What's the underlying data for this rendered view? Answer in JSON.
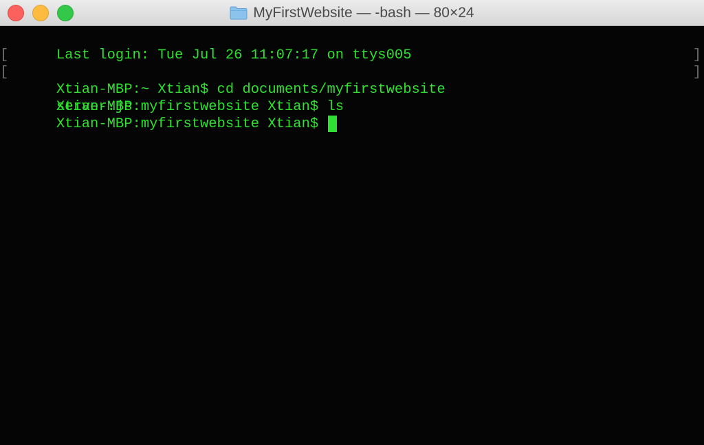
{
  "window": {
    "title": "MyFirstWebsite — -bash — 80×24"
  },
  "terminal": {
    "lines": [
      {
        "text": "Last login: Tue Jul 26 11:07:17 on ttys005",
        "marked": false
      },
      {
        "text": "Xtian-MBP:~ Xtian$ cd documents/myfirstwebsite",
        "marked": true
      },
      {
        "text": "Xtian-MBP:myfirstwebsite Xtian$ ls",
        "marked": true
      },
      {
        "text": "server.js",
        "marked": false
      },
      {
        "text": "Xtian-MBP:myfirstwebsite Xtian$ ",
        "marked": false
      }
    ],
    "mark_left": "[",
    "mark_right": "]"
  },
  "colors": {
    "text": "#2fe030",
    "background": "#050505",
    "close": "#fc615d",
    "minimize": "#fdbc40",
    "zoom": "#34c84a"
  },
  "icons": {
    "title_icon": "folder-icon",
    "cursor": "block-cursor"
  }
}
